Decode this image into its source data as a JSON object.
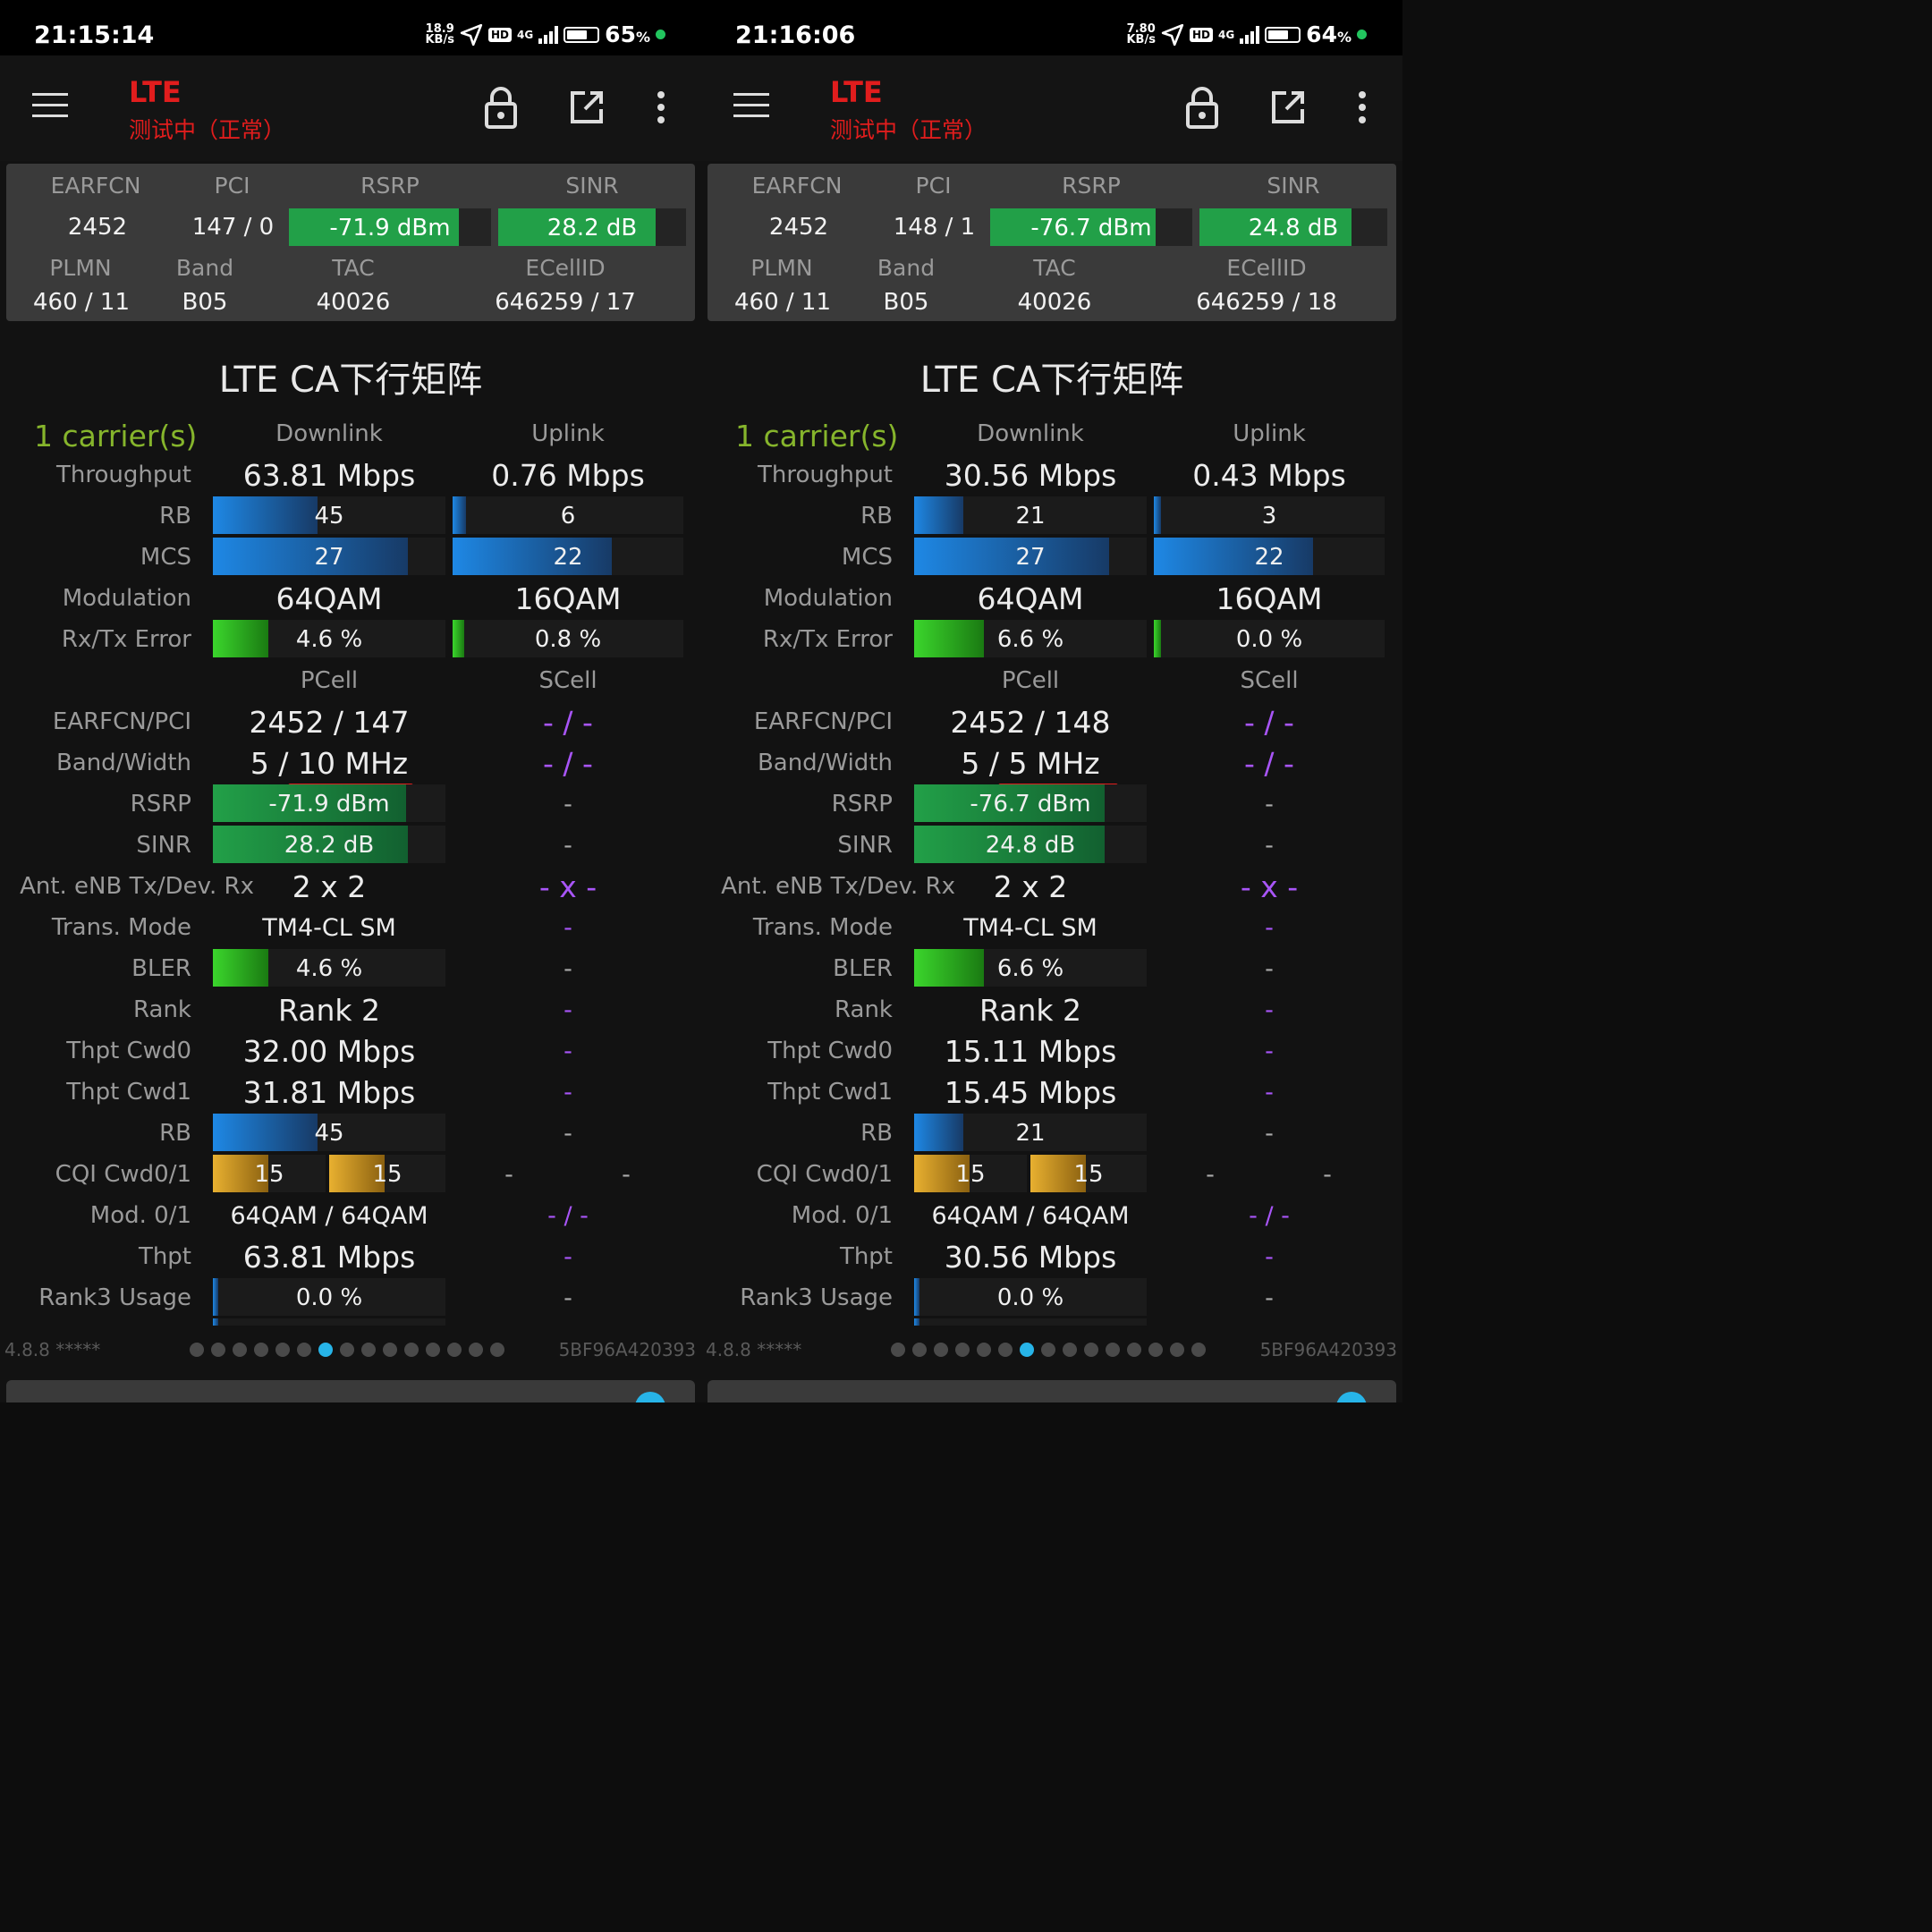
{
  "colors": {
    "accent_red": "#e11d1d",
    "signal_green": "#22a048",
    "bar_blue": "#1e88e5",
    "cqi_gold": "#e8b030",
    "carrier_green": "#86b52c",
    "empty_purple": "#a855f7",
    "page_dot_active": "#27b4e8"
  },
  "labels": {
    "earfcn": "EARFCN",
    "pci": "PCI",
    "rsrp": "RSRP",
    "sinr": "SINR",
    "plmn": "PLMN",
    "band": "Band",
    "tac": "TAC",
    "ecellid": "ECellID",
    "ca_title": "LTE CA下行矩阵",
    "downlink": "Downlink",
    "uplink": "Uplink",
    "pcell": "PCell",
    "scell": "SCell",
    "throughput": "Throughput",
    "rb": "RB",
    "mcs": "MCS",
    "modulation": "Modulation",
    "rxtx_error": "Rx/Tx Error",
    "earfcn_pci": "EARFCN/PCI",
    "band_width": "Band/Width",
    "ant": "Ant. eNB Tx/Dev. Rx",
    "trans_mode": "Trans. Mode",
    "bler": "BLER",
    "rank": "Rank",
    "thpt_cwd0": "Thpt Cwd0",
    "thpt_cwd1": "Thpt Cwd1",
    "cqi": "CQI Cwd0/1",
    "mod01": "Mod. 0/1",
    "thpt": "Thpt",
    "rank3": "Rank3 Usage"
  },
  "screens": [
    {
      "status": {
        "time": "21:15:14",
        "net_speed_value": "18.9",
        "net_speed_unit": "KB/s",
        "hd": "HD",
        "net_type": "4G",
        "battery": "65",
        "battery_level": 0.65
      },
      "app": {
        "title": "LTE",
        "subtitle": "测试中（正常）"
      },
      "info": {
        "earfcn": "2452",
        "pci": "147 / 0",
        "rsrp": "-71.9 dBm",
        "rsrp_level": 0.84,
        "sinr": "28.2 dB",
        "sinr_level": 0.84,
        "plmn": "460 / 11",
        "band": "B05",
        "tac": "40026",
        "ecellid": "646259 / 17"
      },
      "ca": {
        "carriers": "1 carrier(s)",
        "dl_throughput": "63.81 Mbps",
        "ul_throughput": "0.76 Mbps",
        "dl_rb": "45",
        "dl_rb_level": 0.45,
        "ul_rb": "6",
        "ul_rb_level": 0.06,
        "dl_mcs": "27",
        "dl_mcs_level": 0.84,
        "ul_mcs": "22",
        "ul_mcs_level": 0.69,
        "dl_mod": "64QAM",
        "ul_mod": "16QAM",
        "dl_err": "4.6 %",
        "dl_err_level": 0.24,
        "ul_err": "0.8 %",
        "ul_err_level": 0.05,
        "pcell_earfcn_pci": "2452 / 147",
        "scell_earfcn_pci": "- / -",
        "pcell_band_width": "5 / 10 MHz",
        "scell_band_width": "- / -",
        "pcell_rsrp": "-71.9 dBm",
        "pcell_rsrp_level": 0.83,
        "scell_rsrp": "-",
        "pcell_sinr": "28.2 dB",
        "pcell_sinr_level": 0.84,
        "scell_sinr": "-",
        "pcell_ant": "2 x 2",
        "scell_ant": "- x -",
        "pcell_tm": "TM4-CL SM",
        "scell_tm": "-",
        "pcell_bler": "4.6 %",
        "pcell_bler_level": 0.24,
        "scell_bler": "-",
        "pcell_rank": "Rank 2",
        "scell_rank": "-",
        "pcell_cwd0": "32.00 Mbps",
        "scell_cwd0": "-",
        "pcell_cwd1": "31.81 Mbps",
        "scell_cwd1": "-",
        "pcell_rb": "45",
        "pcell_rb_level": 0.45,
        "scell_rb": "-",
        "pcell_cqi0": "15",
        "pcell_cqi1": "15",
        "scell_cqi0": "-",
        "scell_cqi1": "-",
        "pcell_mod01": "64QAM / 64QAM",
        "scell_mod01": "- / -",
        "pcell_thpt": "63.81 Mbps",
        "scell_thpt": "-",
        "pcell_rank3": "0.0 %",
        "scell_rank3": "-"
      },
      "footer": {
        "version": "4.8.8 *****",
        "device_id": "5BF96A420393"
      }
    },
    {
      "status": {
        "time": "21:16:06",
        "net_speed_value": "7.80",
        "net_speed_unit": "KB/s",
        "hd": "HD",
        "net_type": "4G",
        "battery": "64",
        "battery_level": 0.64
      },
      "app": {
        "title": "LTE",
        "subtitle": "测试中（正常）"
      },
      "info": {
        "earfcn": "2452",
        "pci": "148 / 1",
        "rsrp": "-76.7 dBm",
        "rsrp_level": 0.82,
        "sinr": "24.8 dB",
        "sinr_level": 0.81,
        "plmn": "460 / 11",
        "band": "B05",
        "tac": "40026",
        "ecellid": "646259 / 18"
      },
      "ca": {
        "carriers": "1 carrier(s)",
        "dl_throughput": "30.56 Mbps",
        "ul_throughput": "0.43 Mbps",
        "dl_rb": "21",
        "dl_rb_level": 0.21,
        "ul_rb": "3",
        "ul_rb_level": 0.03,
        "dl_mcs": "27",
        "dl_mcs_level": 0.84,
        "ul_mcs": "22",
        "ul_mcs_level": 0.69,
        "dl_mod": "64QAM",
        "ul_mod": "16QAM",
        "dl_err": "6.6 %",
        "dl_err_level": 0.3,
        "ul_err": "0.0 %",
        "ul_err_level": 0.02,
        "pcell_earfcn_pci": "2452 / 148",
        "scell_earfcn_pci": "- / -",
        "pcell_band_width": "5 / 5 MHz",
        "scell_band_width": "- / -",
        "pcell_rsrp": "-76.7 dBm",
        "pcell_rsrp_level": 0.82,
        "scell_rsrp": "-",
        "pcell_sinr": "24.8 dB",
        "pcell_sinr_level": 0.82,
        "scell_sinr": "-",
        "pcell_ant": "2 x 2",
        "scell_ant": "- x -",
        "pcell_tm": "TM4-CL SM",
        "scell_tm": "-",
        "pcell_bler": "6.6 %",
        "pcell_bler_level": 0.3,
        "scell_bler": "-",
        "pcell_rank": "Rank 2",
        "scell_rank": "-",
        "pcell_cwd0": "15.11 Mbps",
        "scell_cwd0": "-",
        "pcell_cwd1": "15.45 Mbps",
        "scell_cwd1": "-",
        "pcell_rb": "21",
        "pcell_rb_level": 0.21,
        "scell_rb": "-",
        "pcell_cqi0": "15",
        "pcell_cqi1": "15",
        "scell_cqi0": "-",
        "scell_cqi1": "-",
        "pcell_mod01": "64QAM / 64QAM",
        "scell_mod01": "- / -",
        "pcell_thpt": "30.56 Mbps",
        "scell_thpt": "-",
        "pcell_rank3": "0.0 %",
        "scell_rank3": "-"
      },
      "footer": {
        "version": "4.8.8 *****",
        "device_id": "5BF96A420393"
      }
    }
  ]
}
